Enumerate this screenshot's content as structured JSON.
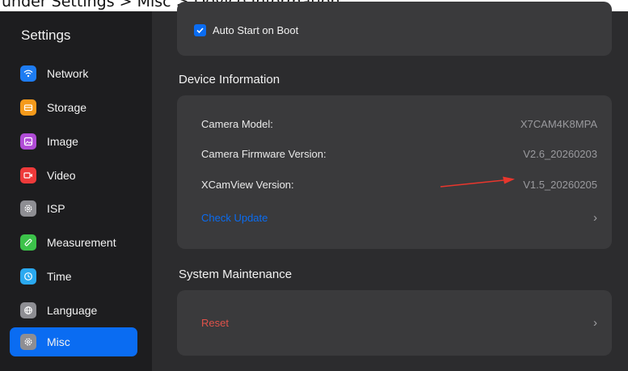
{
  "caption": "under Settings > Misc > Device Information.",
  "sidebar": {
    "title": "Settings",
    "items": [
      {
        "label": "Network",
        "icon": "wifi-icon",
        "color": "#1e7cf2"
      },
      {
        "label": "Storage",
        "icon": "storage-icon",
        "color": "#f59a1b"
      },
      {
        "label": "Image",
        "icon": "image-icon",
        "color": "#b04cd6"
      },
      {
        "label": "Video",
        "icon": "video-icon",
        "color": "#ee3a3a"
      },
      {
        "label": "ISP",
        "icon": "gear-icon",
        "color": "#8e8e93"
      },
      {
        "label": "Measurement",
        "icon": "ruler-icon",
        "color": "#3cc24a"
      },
      {
        "label": "Time",
        "icon": "clock-icon",
        "color": "#2aa9f0"
      },
      {
        "label": "Language",
        "icon": "globe-icon",
        "color": "#8e8e93"
      },
      {
        "label": "Misc",
        "icon": "gear-icon",
        "color": "#8e8e93"
      }
    ],
    "active": "Misc"
  },
  "main": {
    "auto_start": {
      "label": "Auto Start on Boot",
      "checked": true
    },
    "device_info": {
      "title": "Device Information",
      "rows": [
        {
          "key": "Camera Model:",
          "value": "X7CAM4K8MPA"
        },
        {
          "key": "Camera Firmware Version:",
          "value": "V2.6_20260203"
        },
        {
          "key": "XCamView Version:",
          "value": "V1.5_20260205"
        }
      ],
      "check_update": "Check Update"
    },
    "maintenance": {
      "title": "System Maintenance",
      "reset": "Reset"
    },
    "chevron": "›"
  },
  "colors": {
    "accent": "#0a6cf2",
    "danger": "#e0524a",
    "annotation_arrow": "#e8362d"
  }
}
